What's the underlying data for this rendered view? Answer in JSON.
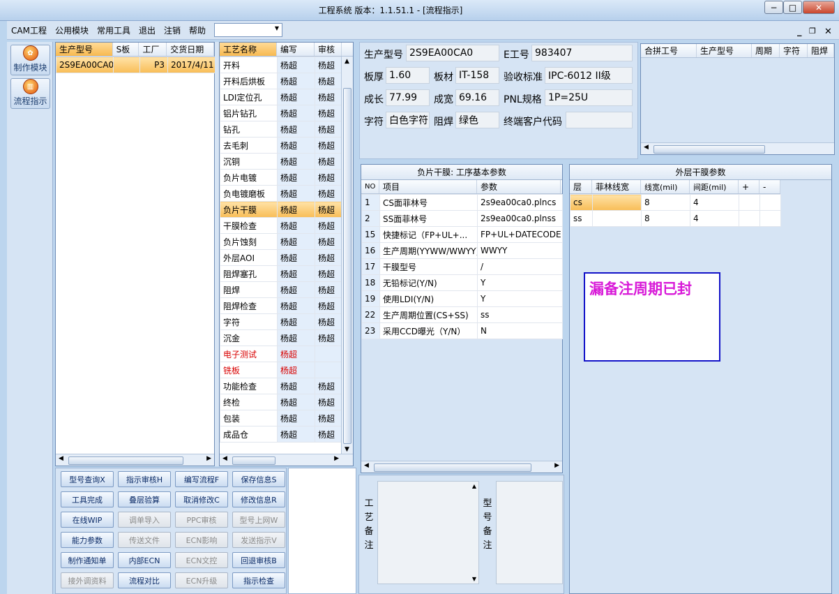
{
  "window": {
    "title": "工程系统   版本：1.1.51.1 - [流程指示]",
    "min": "−",
    "max": "□",
    "close": "✕"
  },
  "menu": {
    "items": [
      "CAM工程",
      "公用模块",
      "常用工具",
      "退出",
      "注销",
      "帮助"
    ],
    "combo_value": ""
  },
  "mdi_controls": {
    "min": "_",
    "restore": "❐",
    "close": "✕"
  },
  "sidebar": {
    "items": [
      {
        "label": "制作模块",
        "icon": "make-module-icon"
      },
      {
        "label": "流程指示",
        "icon": "flow-guide-icon"
      }
    ]
  },
  "orders": {
    "headers": [
      "生产型号",
      "S板",
      "工厂",
      "交货日期"
    ],
    "rows": [
      {
        "model": "2S9EA00CA0",
        "s": "",
        "factory": "P3",
        "date": "2017/4/11"
      }
    ]
  },
  "process": {
    "headers": [
      "工艺名称",
      "编写",
      "审核"
    ],
    "selected_index": 9,
    "rows": [
      {
        "name": "开料",
        "writer": "杨超",
        "reviewer": "杨超"
      },
      {
        "name": "开料后烘板",
        "writer": "杨超",
        "reviewer": "杨超"
      },
      {
        "name": "LDI定位孔",
        "writer": "杨超",
        "reviewer": "杨超"
      },
      {
        "name": "铝片钻孔",
        "writer": "杨超",
        "reviewer": "杨超"
      },
      {
        "name": "钻孔",
        "writer": "杨超",
        "reviewer": "杨超"
      },
      {
        "name": "去毛刺",
        "writer": "杨超",
        "reviewer": "杨超"
      },
      {
        "name": "沉铜",
        "writer": "杨超",
        "reviewer": "杨超"
      },
      {
        "name": "负片电镀",
        "writer": "杨超",
        "reviewer": "杨超"
      },
      {
        "name": "负电镀磨板",
        "writer": "杨超",
        "reviewer": "杨超"
      },
      {
        "name": "负片干膜",
        "writer": "杨超",
        "reviewer": "杨超"
      },
      {
        "name": "干膜检查",
        "writer": "杨超",
        "reviewer": "杨超"
      },
      {
        "name": "负片蚀刻",
        "writer": "杨超",
        "reviewer": "杨超"
      },
      {
        "name": "外层AOI",
        "writer": "杨超",
        "reviewer": "杨超"
      },
      {
        "name": "阻焊塞孔",
        "writer": "杨超",
        "reviewer": "杨超"
      },
      {
        "name": "阻焊",
        "writer": "杨超",
        "reviewer": "杨超"
      },
      {
        "name": "阻焊检查",
        "writer": "杨超",
        "reviewer": "杨超"
      },
      {
        "name": "字符",
        "writer": "杨超",
        "reviewer": "杨超"
      },
      {
        "name": "沉金",
        "writer": "杨超",
        "reviewer": "杨超"
      },
      {
        "name": "电子测试",
        "writer": "杨超",
        "reviewer": "",
        "red": true
      },
      {
        "name": "铣板",
        "writer": "杨超",
        "reviewer": "",
        "red": true
      },
      {
        "name": "功能检查",
        "writer": "杨超",
        "reviewer": "杨超"
      },
      {
        "name": "终检",
        "writer": "杨超",
        "reviewer": "杨超"
      },
      {
        "name": "包装",
        "writer": "杨超",
        "reviewer": "杨超"
      },
      {
        "name": "成品仓",
        "writer": "杨超",
        "reviewer": "杨超"
      }
    ]
  },
  "buttons": [
    {
      "label": "型号查询X",
      "enabled": true
    },
    {
      "label": "指示审核H",
      "enabled": true
    },
    {
      "label": "编写流程F",
      "enabled": true
    },
    {
      "label": "保存信息S",
      "enabled": true
    },
    {
      "label": "工具完成",
      "enabled": true
    },
    {
      "label": "叠层验算",
      "enabled": true
    },
    {
      "label": "取消修改C",
      "enabled": true
    },
    {
      "label": "修改信息R",
      "enabled": true
    },
    {
      "label": "在线WIP",
      "enabled": true
    },
    {
      "label": "调单导入",
      "enabled": false
    },
    {
      "label": "PPC审核",
      "enabled": false
    },
    {
      "label": "型号上网W",
      "enabled": false
    },
    {
      "label": "能力参数",
      "enabled": true
    },
    {
      "label": "传送文件",
      "enabled": false
    },
    {
      "label": "ECN影响",
      "enabled": false
    },
    {
      "label": "发送指示V",
      "enabled": false
    },
    {
      "label": "制作通知单",
      "enabled": true
    },
    {
      "label": "内部ECN",
      "enabled": true
    },
    {
      "label": "ECN文控",
      "enabled": false
    },
    {
      "label": "回退审核B",
      "enabled": true
    },
    {
      "label": "接外调资料",
      "enabled": false
    },
    {
      "label": "流程对比",
      "enabled": true
    },
    {
      "label": "ECN升级",
      "enabled": false
    },
    {
      "label": "指示检查",
      "enabled": true
    }
  ],
  "info": {
    "model_label": "生产型号",
    "model": "2S9EA00CA0",
    "e_label": "E工号",
    "e_no": "983407",
    "thickness_label": "板厚",
    "thickness": "1.60",
    "material_label": "板材",
    "material": "IT-158",
    "standard_label": "验收标准",
    "standard": "IPC-6012 II级",
    "length_label": "成长",
    "length": "77.99",
    "width_label": "成宽",
    "width": "69.16",
    "pnl_label": "PNL规格",
    "pnl": "1P=25U",
    "char_label": "字符",
    "char": "白色字符",
    "mask_label": "阻焊",
    "mask": "绿色",
    "customer_label": "终端客户代码",
    "customer": ""
  },
  "combine": {
    "headers": [
      "合拼工号",
      "生产型号",
      "周期",
      "字符",
      "阻焊"
    ],
    "rows": []
  },
  "params": {
    "title": "负片干膜: 工序基本参数",
    "headers": [
      "NO",
      "项目",
      "参数"
    ],
    "rows": [
      {
        "no": "1",
        "item": "CS面菲林号",
        "value": "2s9ea00ca0.plncs"
      },
      {
        "no": "2",
        "item": "SS面菲林号",
        "value": "2s9ea00ca0.plnss"
      },
      {
        "no": "15",
        "item": "快捷标记（FP+UL+...",
        "value": "FP+UL+DATECODE"
      },
      {
        "no": "16",
        "item": "生产周期(YYWW/WWYY)",
        "value": "WWYY"
      },
      {
        "no": "17",
        "item": "干膜型号",
        "value": "/"
      },
      {
        "no": "18",
        "item": "无铅标记(Y/N)",
        "value": "Y"
      },
      {
        "no": "19",
        "item": "使用LDI(Y/N)",
        "value": "Y"
      },
      {
        "no": "22",
        "item": "生产周期位置(CS+SS)",
        "value": "ss"
      },
      {
        "no": "23",
        "item": "采用CCD曝光（Y/N）",
        "value": "N"
      }
    ]
  },
  "outer": {
    "title": "外层干膜参数",
    "headers": [
      "层",
      "菲林线宽",
      "线宽(mil)",
      "间距(mil)",
      "+",
      "-"
    ],
    "rows": [
      {
        "layer": "cs",
        "film": "",
        "width": "8",
        "space": "4",
        "selected": true
      },
      {
        "layer": "ss",
        "film": "",
        "width": "8",
        "space": "4",
        "selected": false
      }
    ]
  },
  "note": {
    "text": "漏备注周期已封"
  },
  "remarks": {
    "process_label": [
      "工",
      "艺",
      "备",
      "注"
    ],
    "model_label": [
      "型",
      "号",
      "备",
      "注"
    ],
    "process_text": "",
    "model_text": ""
  }
}
